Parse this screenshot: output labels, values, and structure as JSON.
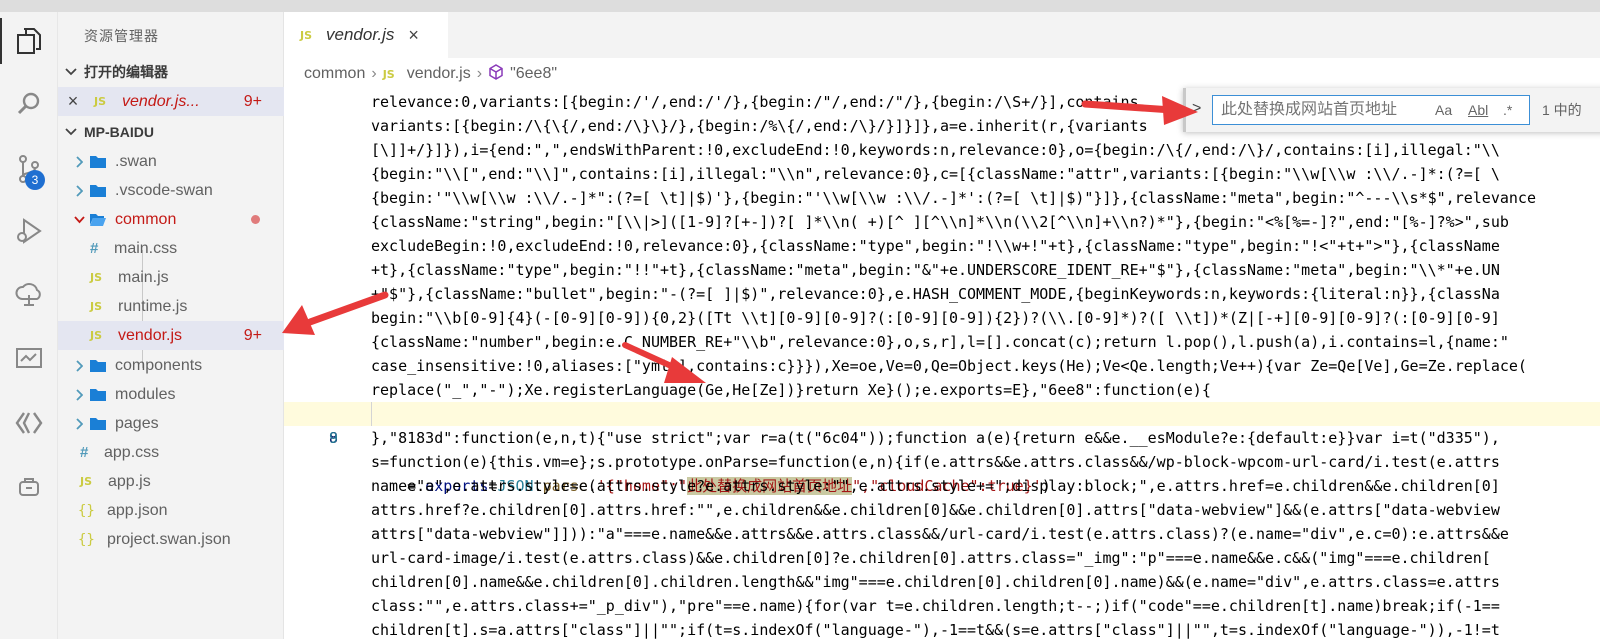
{
  "activity_bar": {
    "items": [
      {
        "name": "explorer-icon"
      },
      {
        "name": "search-icon"
      },
      {
        "name": "source-control-icon",
        "badge": "3"
      },
      {
        "name": "debug-icon"
      },
      {
        "name": "cloud-icon"
      },
      {
        "name": "monitor-icon"
      },
      {
        "name": "swan-icon"
      },
      {
        "name": "extension-icon"
      }
    ]
  },
  "sidebar": {
    "title": "资源管理器",
    "open_editors": {
      "label": "打开的编辑器",
      "files": [
        {
          "close": "×",
          "icon": "JS",
          "name": "vendor.js...",
          "badge": "9+"
        }
      ]
    },
    "project": {
      "label": "MP-BAIDU",
      "tree": [
        {
          "type": "folder",
          "name": ".swan"
        },
        {
          "type": "folder",
          "name": ".vscode-swan"
        },
        {
          "type": "folder-open",
          "name": "common"
        },
        {
          "type": "css",
          "icon": "#",
          "name": "main.css"
        },
        {
          "type": "js",
          "icon": "JS",
          "name": "main.js"
        },
        {
          "type": "js",
          "icon": "JS",
          "name": "runtime.js"
        },
        {
          "type": "js",
          "icon": "JS",
          "name": "vendor.js",
          "badge": "9+"
        },
        {
          "type": "folder",
          "name": "components"
        },
        {
          "type": "folder",
          "name": "modules"
        },
        {
          "type": "folder",
          "name": "pages"
        },
        {
          "type": "css",
          "icon": "#",
          "name": "app.css"
        },
        {
          "type": "js",
          "icon": "JS",
          "name": "app.js"
        },
        {
          "type": "json",
          "icon": "{}",
          "name": "app.json"
        },
        {
          "type": "json",
          "icon": "{}",
          "name": "project.swan.json"
        }
      ]
    }
  },
  "editor": {
    "tab": {
      "icon": "JS",
      "label": "vendor.js",
      "close": "×"
    },
    "breadcrumb": {
      "folder": "common",
      "icon": "JS",
      "file": "vendor.js",
      "symbol": "\"6ee8\""
    },
    "find": {
      "toggle": ">",
      "placeholder": "此处替换成网站首页地址",
      "match_case": "Aa",
      "whole_word": "Abl",
      "regex": ".*",
      "count": "1 中的"
    },
    "lines": [
      {
        "num": "",
        "text": "relevance:0,variants:[{begin:/'/,end:/'/},{begin:/\"/,end:/\"/},{begin:/\\S+/}],contains"
      },
      {
        "num": "",
        "text": "variants:[{begin:/\\{\\{/,end:/\\}\\}/},{begin:/%\\{/,end:/\\}/}]}]},a=e.inherit(r,{variants"
      },
      {
        "num": "",
        "text": "[\\]]+/}]}),i={end:\",\",endsWithParent:!0,excludeEnd:!0,keywords:n,relevance:0},o={begin:/\\{/,end:/\\}/,contains:[i],illegal:\"\\\\"
      },
      {
        "num": "",
        "text": "{begin:\"\\\\[\",end:\"\\\\]\",contains:[i],illegal:\"\\\\n\",relevance:0},c=[{className:\"attr\",variants:[{begin:\"\\\\w[\\\\w :\\\\/.-]*:(?=[ \\"
      },
      {
        "num": "",
        "text": "{begin:'\"\\\\w[\\\\w :\\\\/.-]*\":(?=[ \\t]|$)'},{begin:\"'\\\\w[\\\\w :\\\\/.-]*':(?=[ \\t]|$)\"}]},{className:\"meta\",begin:\"^---\\\\s*$\",relevance"
      },
      {
        "num": "",
        "text": "{className:\"string\",begin:\"[\\\\|>]([1-9]?[+-])?[ ]*\\\\n( +)[^ ][^\\\\n]*\\\\n(\\\\2[^\\\\n]+\\\\n?)*\"},{begin:\"<%[%=-]?\",end:\"[%-]?%>\",sub"
      },
      {
        "num": "",
        "text": "excludeBegin:!0,excludeEnd:!0,relevance:0},{className:\"type\",begin:\"!\\\\w+!\"+t},{className:\"type\",begin:\"!<\"+t+\">\"},{className"
      },
      {
        "num": "",
        "text": "+t},{className:\"type\",begin:\"!!\"+t},{className:\"meta\",begin:\"&\"+e.UNDERSCORE_IDENT_RE+\"$\"},{className:\"meta\",begin:\"\\\\*\"+e.UN"
      },
      {
        "num": "",
        "text": "+\"$\"},{className:\"bullet\",begin:\"-(?=[ ]|$)\",relevance:0},e.HASH_COMMENT_MODE,{beginKeywords:n,keywords:{literal:n}},{classNa"
      },
      {
        "num": "",
        "text": "begin:\"\\\\b[0-9]{4}(-[0-9][0-9]){0,2}([Tt \\\\t][0-9][0-9]?(:[0-9][0-9]){2})?(\\\\.[0-9]*)?([ \\\\t])*(Z|[-+][0-9][0-9]?(:[0-9][0-9]"
      },
      {
        "num": "",
        "text": "{className:\"number\",begin:e.C_NUMBER_RE+\"\\\\b\",relevance:0},o,s,r],l=[].concat(c);return l.pop(),l.push(a),i.contains=l,{name:\""
      },
      {
        "num": "",
        "text": "case_insensitive:!0,aliases:[\"yml\"],contains:c}}}),Xe=oe,Ve=0,Qe=Object.keys(He);Ve<Qe.length;Ve++){var Ze=Qe[Ve],Ge=Ze.replace("
      },
      {
        "num": "",
        "text": "replace(\"_\",\"-\");Xe.registerLanguage(Ge,He[Ze])}return Xe}();e.exports=E},\"6ee8\":function(e){"
      },
      {
        "num": "8",
        "text_parts": {
          "a": "    e.",
          "b": "exports",
          "c": "=",
          "d": "JSON",
          "e": ".",
          "f": "parse",
          "g": "(",
          "h": "'{\"home\":\"",
          "i": "此处替换成网站首页地址",
          "j": "\",\"cloudCache\":true}'",
          "k": ")"
        }
      },
      {
        "num": "9",
        "text": "},\"8183d\":function(e,n,t){\"use strict\";var r=a(t(\"6c04\"));function a(e){return e&&e.__esModule?e:{default:e}}var i=t(\"d335\"),"
      },
      {
        "num": "",
        "text": "s=function(e){this.vm=e};s.prototype.onParse=function(e,n){if(e.attrs&&e.attrs.class&&/wp-block-wpcom-url-card/i.test(e.attrs"
      },
      {
        "num": "",
        "text": "name=\"a\",e.attrs.style=e.attrs.style?e.attrs.style:\"\",e.attrs.style+=\";display:block;\",e.attrs.href=e.children&&e.children[0]"
      },
      {
        "num": "",
        "text": "attrs.href?e.children[0].attrs.href:\"\",e.children&&e.children[0]&&e.children[0].attrs[\"data-webview\"]&&(e.attrs[\"data-webview"
      },
      {
        "num": "",
        "text": "attrs[\"data-webview\"]])):\"a\"===e.name&&e.attrs&&e.attrs.class&&/url-card/i.test(e.attrs.class)?(e.name=\"div\",e.c=0):e.attrs&&e"
      },
      {
        "num": "",
        "text": "url-card-image/i.test(e.attrs.class)&&e.children[0]?e.children[0].attrs.class=\"_img\":\"p\"===e.name&&e.c&&(\"img\"===e.children["
      },
      {
        "num": "",
        "text": "children[0].name&&e.children[0].children.length&&\"img\"===e.children[0].children[0].name)&&(e.name=\"div\",e.attrs.class=e.attrs"
      },
      {
        "num": "",
        "text": "class:\"\",e.attrs.class+=\"_p_div\"),\"pre\"==e.name){for(var t=e.children.length;t--;)if(\"code\"==e.children[t].name)break;if(-1=="
      },
      {
        "num": "",
        "text": "children[t].s=a.attrs[\"class\"]||\"\";if(t=s.indexOf(\"language-\"),-1==t&&(s=e.attrs[\"class\"]||\"\",t=s.indexOf(\"language-\")),-1!=t"
      }
    ]
  }
}
